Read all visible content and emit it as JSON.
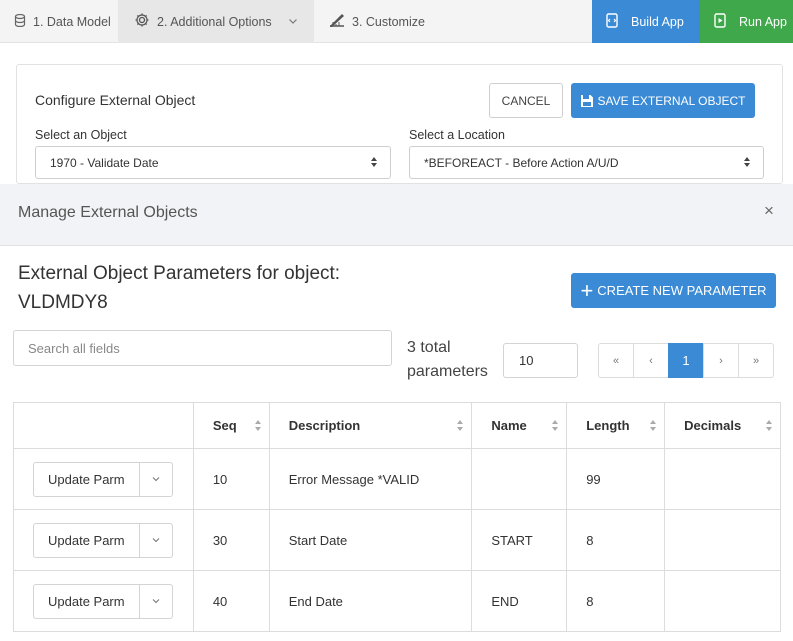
{
  "nav": {
    "steps": [
      {
        "label": "1. Data Model",
        "icon": "database-icon"
      },
      {
        "label": "2. Additional Options",
        "icon": "gear-icon"
      },
      {
        "label": "3. Customize",
        "icon": "pencil-ruler-icon"
      }
    ],
    "build_label": "Build App",
    "run_label": "Run App",
    "colors": {
      "build": "#3a8ad6",
      "run": "#3ea84a"
    }
  },
  "config": {
    "title": "Configure External Object",
    "cancel_label": "CANCEL",
    "save_label": "SAVE EXTERNAL OBJECT",
    "object_label": "Select an Object",
    "object_value": "1970 - Validate Date",
    "location_label": "Select a Location",
    "location_value": "*BEFOREACT - Before Action A/U/D"
  },
  "manage": {
    "title": "Manage External Objects",
    "close": "×"
  },
  "params": {
    "title_line1": "External Object Parameters for object:",
    "title_line2": "VLDMDY8",
    "create_label": "CREATE NEW PARAMETER",
    "search_placeholder": "Search all fields",
    "total_line1": "3 total",
    "total_line2": "parameters",
    "page_size": "10",
    "pager": [
      "«",
      "‹",
      "1",
      "›",
      "»"
    ],
    "current_page": "1"
  },
  "table": {
    "headers": [
      "",
      "Seq",
      "Description",
      "Name",
      "Length",
      "Decimals"
    ],
    "action_label": "Update Parm",
    "rows": [
      {
        "seq": "10",
        "description": "Error Message *VALID",
        "name": "",
        "length": "99",
        "decimals": ""
      },
      {
        "seq": "30",
        "description": "Start Date",
        "name": "START",
        "length": "8",
        "decimals": ""
      },
      {
        "seq": "40",
        "description": "End Date",
        "name": "END",
        "length": "8",
        "decimals": ""
      }
    ]
  },
  "accent": "#3a8ad6"
}
